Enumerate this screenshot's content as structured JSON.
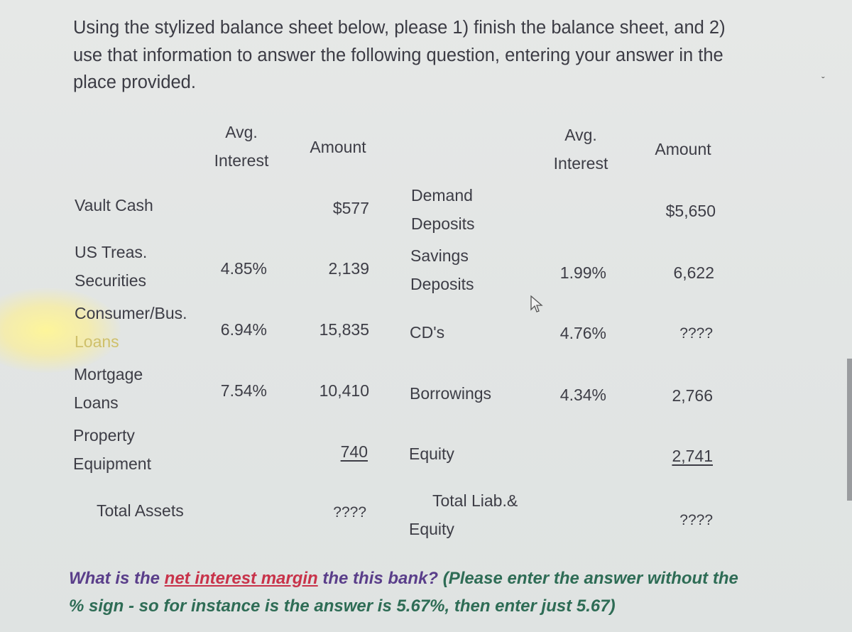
{
  "intro_text": "Using the stylized balance sheet below, please 1) finish the balance sheet, and 2) use that information to answer the following question, entering your answer in the place provided.",
  "balance_sheet": {
    "assets": {
      "headers": {
        "rate_line1": "Avg.",
        "rate_line2": "Interest",
        "amount": "Amount"
      },
      "rows": [
        {
          "label_line1": "Vault Cash",
          "label_line2": "",
          "rate": "",
          "amount": "$577"
        },
        {
          "label_line1": "US Treas.",
          "label_line2": "Securities",
          "rate": "4.85%",
          "amount": "2,139"
        },
        {
          "label_line1": "Consumer/Bus.",
          "label_line2": "Loans",
          "rate": "6.94%",
          "amount": "15,835"
        },
        {
          "label_line1": "Mortgage",
          "label_line2": "Loans",
          "rate": "7.54%",
          "amount": "10,410"
        },
        {
          "label_line1": "Property",
          "label_line2": "Equipment",
          "rate": "",
          "amount": "740"
        }
      ],
      "total": {
        "label": "Total Assets",
        "amount": "????"
      }
    },
    "liabilities": {
      "headers": {
        "rate_line1": "Avg.",
        "rate_line2": "Interest",
        "amount": "Amount"
      },
      "rows": [
        {
          "label_line1": "Demand",
          "label_line2": "Deposits",
          "rate": "",
          "amount": "$5,650"
        },
        {
          "label_line1": "Savings",
          "label_line2": "Deposits",
          "rate": "1.99%",
          "amount": "6,622"
        },
        {
          "label_line1": "CD's",
          "label_line2": "",
          "rate": "4.76%",
          "amount": "????"
        },
        {
          "label_line1": "Borrowings",
          "label_line2": "",
          "rate": "4.34%",
          "amount": "2,766"
        },
        {
          "label_line1": "Equity",
          "label_line2": "",
          "rate": "",
          "amount": "2,741"
        }
      ],
      "total": {
        "label_line1": "Total Liab.&",
        "label_line2": "Equity",
        "amount": "????"
      }
    }
  },
  "question": {
    "part1": "What is the ",
    "highlight": "net interest margin",
    "part2": " the this bank?",
    "part3": " (Please enter the answer without the % sign - so for instance is the answer is 5.67%, then enter just 5.67)"
  },
  "colors": {
    "question_purple": "#5a3e8a",
    "question_red": "#c8334a",
    "question_green": "#2e6c55"
  }
}
